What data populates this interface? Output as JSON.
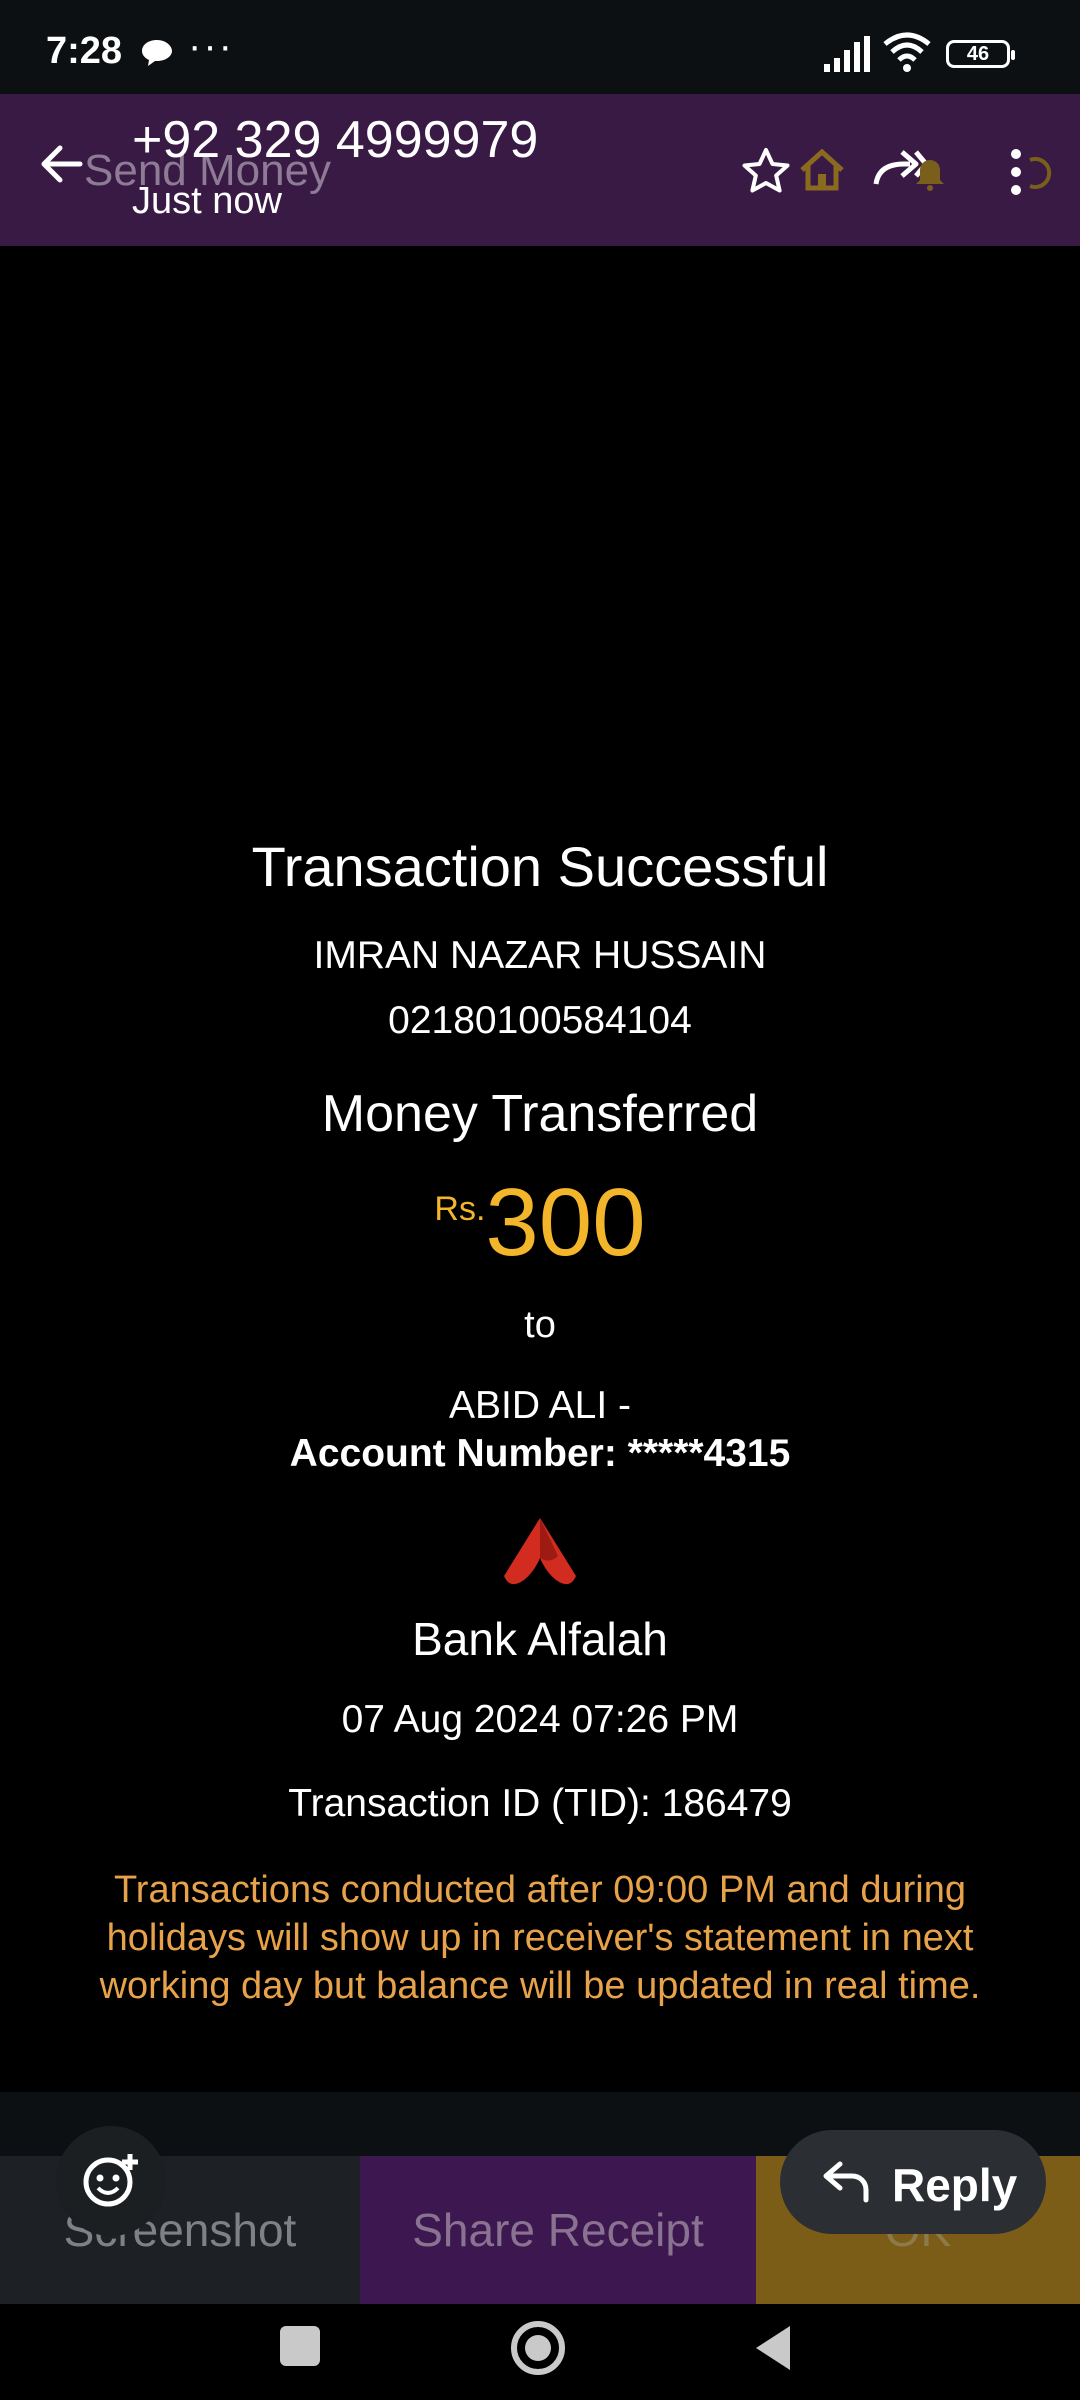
{
  "status_bar": {
    "time": "7:28",
    "more": "···",
    "battery": "46"
  },
  "header": {
    "ghost_title": "Send Money",
    "contact_number": "+92 329 4999979",
    "timestamp": "Just now"
  },
  "receipt": {
    "title": "Transaction Successful",
    "sender_name": "IMRAN NAZAR HUSSAIN",
    "sender_account": "02180100584104",
    "money_label": "Money Transferred",
    "currency": "Rs.",
    "amount": "300",
    "to_label": "to",
    "recipient": "ABID ALI -",
    "recipient_account": "Account Number: *****4315",
    "bank_name": "Bank Alfalah",
    "datetime": "07 Aug 2024 07:26 PM",
    "tid": "Transaction ID (TID): 186479",
    "note": "Transactions conducted after 09:00 PM and during holidays will show up in receiver's statement in next working day but balance will be updated in real time."
  },
  "actions": {
    "screenshot": "Screenshot",
    "share": "Share Receipt",
    "ok": "OK",
    "reply": "Reply"
  },
  "colors": {
    "header_bg": "#391a45",
    "amount": "#f3b52a",
    "note": "#e8a24a",
    "bank_logo": "#d22b1f"
  }
}
